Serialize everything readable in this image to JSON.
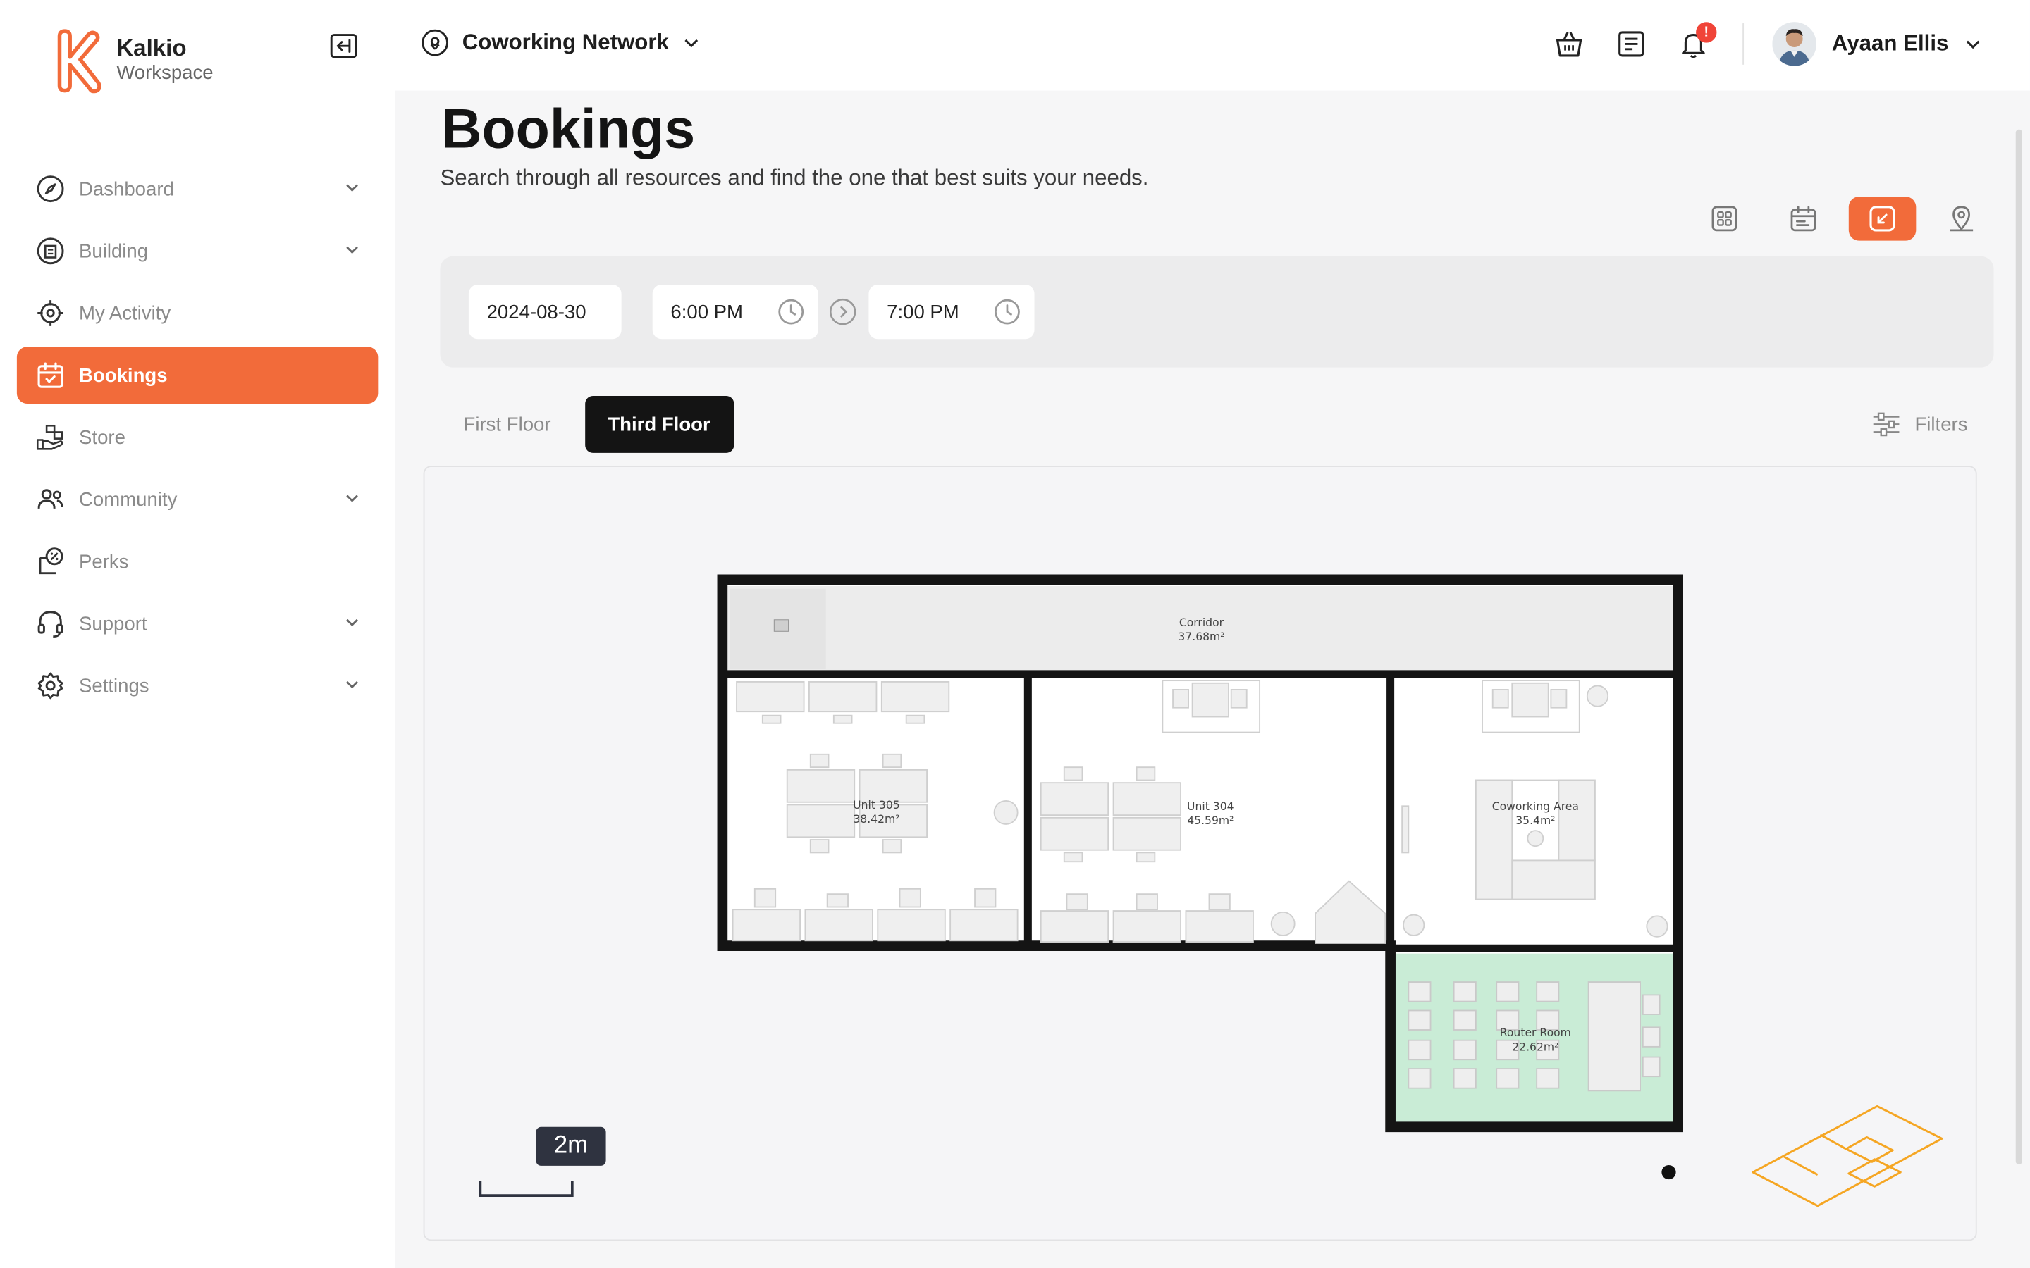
{
  "brand": {
    "name": "Kalkio",
    "sub": "Workspace"
  },
  "sidebar": {
    "items": [
      {
        "label": "Dashboard",
        "icon": "compass-icon",
        "has_submenu": true
      },
      {
        "label": "Building",
        "icon": "building-icon",
        "has_submenu": true
      },
      {
        "label": "My Activity",
        "icon": "target-icon",
        "has_submenu": false
      },
      {
        "label": "Bookings",
        "icon": "calendar-check-icon",
        "has_submenu": false,
        "active": true
      },
      {
        "label": "Store",
        "icon": "store-hand-icon",
        "has_submenu": false
      },
      {
        "label": "Community",
        "icon": "people-icon",
        "has_submenu": true
      },
      {
        "label": "Perks",
        "icon": "perks-icon",
        "has_submenu": false
      },
      {
        "label": "Support",
        "icon": "headset-icon",
        "has_submenu": true
      },
      {
        "label": "Settings",
        "icon": "gear-icon",
        "has_submenu": true
      }
    ]
  },
  "header": {
    "location": "Coworking Network",
    "notification_badge": "!",
    "user_name": "Ayaan Ellis"
  },
  "page": {
    "title": "Bookings",
    "subtitle": "Search through all resources and find the one that best suits your needs."
  },
  "view_modes": [
    {
      "icon": "grid-icon",
      "active": false
    },
    {
      "icon": "calendar-list-icon",
      "active": false
    },
    {
      "icon": "floorplan-icon",
      "active": true
    },
    {
      "icon": "map-pin-icon",
      "active": false
    }
  ],
  "search": {
    "date": "2024-08-30",
    "start_time": "6:00 PM",
    "end_time": "7:00 PM"
  },
  "floor_tabs": [
    {
      "label": "First Floor",
      "active": false
    },
    {
      "label": "Third Floor",
      "active": true
    }
  ],
  "filters_label": "Filters",
  "floorplan": {
    "rooms": [
      {
        "name": "Corridor",
        "area": "37.68m²"
      },
      {
        "name": "Unit 305",
        "area": "38.42m²"
      },
      {
        "name": "Unit 304",
        "area": "45.59m²"
      },
      {
        "name": "Coworking Area",
        "area": "35.4m²"
      },
      {
        "name": "Router Room",
        "area": "22.62m²",
        "highlight_color": "#c9ecd6"
      }
    ],
    "scale_label": "2m",
    "accent_color": "#f5a623"
  },
  "colors": {
    "accent": "#f26b3a",
    "dark": "#141414"
  }
}
